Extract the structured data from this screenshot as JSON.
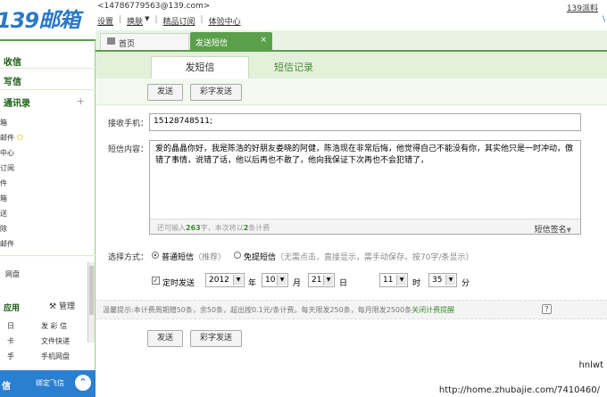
{
  "header": {
    "logo_text": "139邮箱",
    "account": "<14786779563@139.com>",
    "links": [
      "设置",
      "换肤",
      "精品订阅",
      "体验中心"
    ],
    "right_link": "139派料",
    "right_link2": "\\"
  },
  "sidebar": {
    "items": [
      "收信",
      "写信",
      "通讯录"
    ],
    "plus": "+",
    "subitems": [
      "箱",
      "邮件",
      "中心",
      "订阅",
      "件",
      "箱",
      "送",
      "除",
      "邮件"
    ],
    "folder_label": "网盘",
    "apps": {
      "title": "应用",
      "manage": "管理",
      "rows": [
        [
          "日",
          "发 彩 信"
        ],
        [
          "卡",
          "文件快递"
        ],
        [
          "手",
          "手机网盘"
        ]
      ]
    },
    "bottom": {
      "label": "信",
      "bind_label": "绑定飞信",
      "icon": "chevron-up-icon"
    }
  },
  "tabs": {
    "home": "首页",
    "active": "发送短信",
    "close": "×"
  },
  "subtabs": {
    "compose": "发短信",
    "records": "短信记录"
  },
  "toolbar": {
    "send": "发送",
    "mms": "彩字发送"
  },
  "form": {
    "phone_label": "接收手机：",
    "phone_value": "15128748511;",
    "content_label": "短信内容：",
    "content_value": "爱的晶晶你好，我是陈浩的好朋友娄晓的阿健，陈浩现在非常后悔，他觉得自己不能没有你，其实他只是一时冲动，傲错了事情，说错了话，他以后再也不敢了，他向我保证下次再也不会犯错了，",
    "counter_prefix": "还可输入",
    "counter_value": "263",
    "counter_suffix": "字，本次将以",
    "counter_count": "2",
    "counter_end": "条计费",
    "signature": "短信签名",
    "method_label": "选择方式：",
    "method_normal": "普通短信",
    "method_normal_note": "（推荐）",
    "method_free": "免提短信",
    "method_free_note": "（无需点击，直接显示，需手动保存。按70字/条显示）",
    "timed_label": "定时发送",
    "year": "2012",
    "year_unit": "年",
    "month": "10",
    "month_unit": "月",
    "day": "21",
    "day_unit": "日",
    "hour": "11",
    "hour_unit": "时",
    "minute": "35",
    "minute_unit": "分"
  },
  "tip": {
    "text": "温馨提示:本计费周期赠50条，余50条，超出按0.1元/条计费。每天限发250条，每月限发2500条",
    "link": "关闭计费提醒",
    "help": "?"
  },
  "bottom_buttons": {
    "send": "发送",
    "mms": "彩字发送"
  },
  "watermark": {
    "line1": "hnlwt",
    "line2": "http://home.zhubajie.com/7410460/"
  }
}
